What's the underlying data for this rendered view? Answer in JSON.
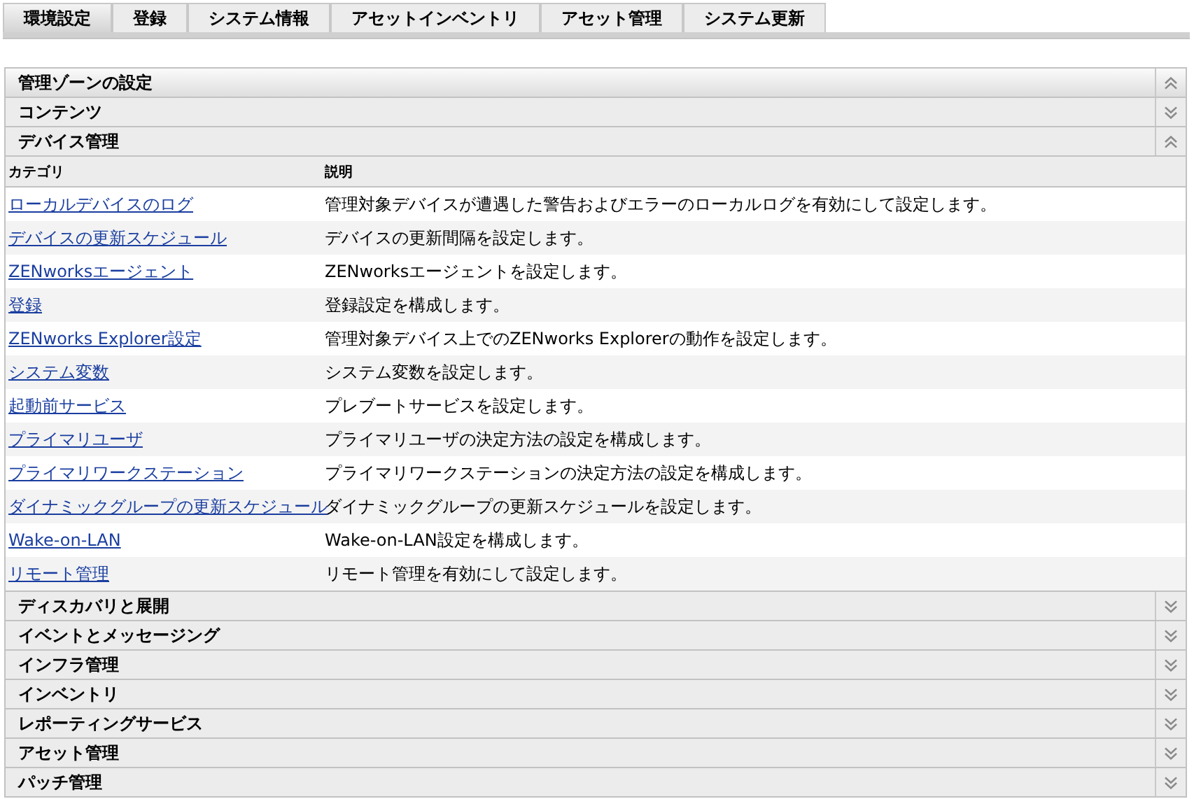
{
  "tabs": [
    {
      "label": "環境設定",
      "selected": true
    },
    {
      "label": "登録",
      "selected": false
    },
    {
      "label": "システム情報",
      "selected": false
    },
    {
      "label": "アセットインベントリ",
      "selected": false
    },
    {
      "label": "アセット管理",
      "selected": false
    },
    {
      "label": "システム更新",
      "selected": false
    }
  ],
  "zone_header": {
    "title": "管理ゾーンの設定",
    "expanded": true
  },
  "sections": [
    {
      "title": "コンテンツ",
      "expanded": false
    },
    {
      "title": "デバイス管理",
      "expanded": true,
      "table": {
        "columns": [
          "カテゴリ",
          "説明"
        ],
        "rows": [
          {
            "category": "ローカルデバイスのログ",
            "description": "管理対象デバイスが遭遇した警告およびエラーのローカルログを有効にして設定します。"
          },
          {
            "category": "デバイスの更新スケジュール",
            "description": "デバイスの更新間隔を設定します。"
          },
          {
            "category": "ZENworksエージェント",
            "description": "ZENworksエージェントを設定します。"
          },
          {
            "category": "登録",
            "description": "登録設定を構成します。"
          },
          {
            "category": "ZENworks Explorer設定",
            "description": "管理対象デバイス上でのZENworks Explorerの動作を設定します。"
          },
          {
            "category": "システム変数",
            "description": "システム変数を設定します。"
          },
          {
            "category": "起動前サービス",
            "description": "プレブートサービスを設定します。"
          },
          {
            "category": "プライマリユーザ",
            "description": "プライマリユーザの決定方法の設定を構成します。"
          },
          {
            "category": "プライマリワークステーション",
            "description": "プライマリワークステーションの決定方法の設定を構成します。"
          },
          {
            "category": "ダイナミックグループの更新スケジュール",
            "description": "ダイナミックグループの更新スケジュールを設定します。"
          },
          {
            "category": "Wake-on-LAN",
            "description": "Wake-on-LAN設定を構成します。"
          },
          {
            "category": "リモート管理",
            "description": "リモート管理を有効にして設定します。"
          }
        ]
      }
    },
    {
      "title": "ディスカバリと展開",
      "expanded": false
    },
    {
      "title": "イベントとメッセージング",
      "expanded": false
    },
    {
      "title": "インフラ管理",
      "expanded": false
    },
    {
      "title": "インベントリ",
      "expanded": false
    },
    {
      "title": "レポーティングサービス",
      "expanded": false
    },
    {
      "title": "アセット管理",
      "expanded": false
    },
    {
      "title": "パッチ管理",
      "expanded": false
    }
  ]
}
